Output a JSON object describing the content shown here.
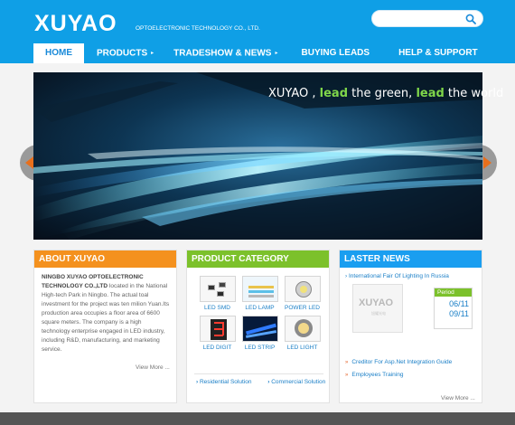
{
  "header": {
    "logo": "XUYAO",
    "logo_sub": "OPTOELECTRONIC TECHNOLOGY CO., LTD.",
    "search_placeholder": ""
  },
  "nav": {
    "items": [
      {
        "label": "HOME"
      },
      {
        "label": "PRODUCTS"
      },
      {
        "label": "TRADESHOW & NEWS"
      },
      {
        "label": "BUYING LEADS"
      },
      {
        "label": "HELP & SUPPORT"
      }
    ],
    "arrow": "▸"
  },
  "banner": {
    "slogan_1": "XUYAO , ",
    "slogan_2": "lead",
    "slogan_3": " the green, ",
    "slogan_4": "lead",
    "slogan_5": " the world"
  },
  "about": {
    "title": "ABOUT XUYAO",
    "company": "NINGBO XUYAO OPTOELECTRONIC TECHNOLOGY CO.,LTD",
    "text": " located in the National High-tech Park in Ningbo. The actual toal investment for the project was ten milion Yuan.Its production area occupies a floor area of 6600 square meters. The company is a high technology enterprise engaged in LED industry, including R&D, manufacturing, and marketing service.",
    "more": "View More ..."
  },
  "category": {
    "title": "PRODUCT CATEGORY",
    "products": [
      {
        "label": "LED SMD"
      },
      {
        "label": "LED LAMP"
      },
      {
        "label": "POWER LED"
      },
      {
        "label": "LED DIGIT"
      },
      {
        "label": "LED STRIP"
      },
      {
        "label": "LED LIGHT"
      }
    ],
    "links": [
      {
        "label": "Residential Solution"
      },
      {
        "label": "Commercial Solution"
      }
    ],
    "link_marker": "›"
  },
  "news": {
    "title": "LASTER NEWS",
    "top_marker": "›",
    "top_item": "International Fair Of Lighting In Russia",
    "img_logo": "XUYAO",
    "img_sub": "旭耀光电",
    "period_label": "Period",
    "period_start": "06/11",
    "period_end": "09/11",
    "items_marker": "»",
    "items": [
      {
        "label": "Creditor For Asp.Net Integration Guide"
      },
      {
        "label": "Employees Training"
      }
    ],
    "more": "View More ..."
  },
  "colors": {
    "header_blue": "#0f9fe6",
    "about_orange": "#f4911e",
    "category_green": "#7cc12b",
    "news_blue": "#1a9ef0"
  }
}
